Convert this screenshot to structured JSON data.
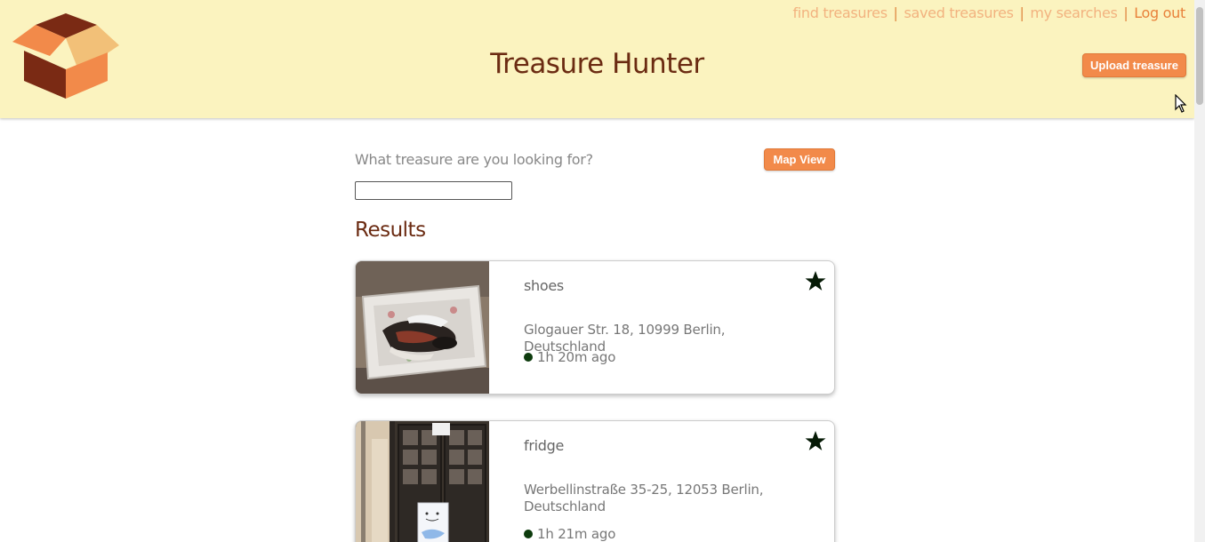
{
  "header": {
    "title": "Treasure Hunter",
    "nav": {
      "find": "find treasures",
      "saved": "saved treasures",
      "searches": "my searches",
      "logout": "Log out",
      "separator": "|"
    },
    "upload_label": "Upload treasure",
    "logo_icon": "open-box-icon"
  },
  "search": {
    "label": "What treasure are you looking for?",
    "value": "",
    "map_view_label": "Map View"
  },
  "results": {
    "heading": "Results",
    "items": [
      {
        "name": "shoes",
        "address": "Glogauer Str. 18, 10999 Berlin, Deutschland",
        "time": "1h 20m ago",
        "starred": true
      },
      {
        "name": "fridge",
        "address": "Werbellinstraße 35-25, 12053 Berlin, Deutschland",
        "time": "1h 21m ago",
        "starred": true
      }
    ]
  },
  "colors": {
    "header_bg": "#fbf3bf",
    "accent": "#f28a4a",
    "title": "#6b2b12",
    "status_dot": "#0d3b0d"
  }
}
